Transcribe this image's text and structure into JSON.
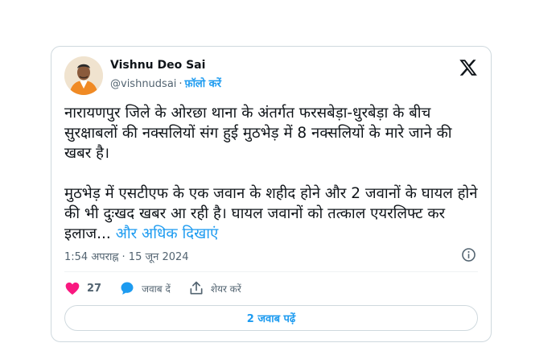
{
  "author": {
    "name": "Vishnu Deo Sai",
    "handle": "@vishnudsai",
    "separator": "·",
    "follow_label": "फ़ॉलो करें"
  },
  "tweet": {
    "paragraph1": "नारायणपुर जिले के ओरछा थाना के अंतर्गत फरसबेड़ा-धुरबेड़ा के बीच सुरक्षाबलों की नक्सलियों संग हुई मुठभेड़ में 8 नक्सलियों के मारे जाने की खबर है।",
    "paragraph2": "मुठभेड़ में एसटीएफ के एक जवान के शहीद होने और 2 जवानों के घायल होने की भी दुःखद खबर आ रही है। घायल जवानों को तत्काल एयरलिफ्ट कर इलाज...",
    "show_more": "और अधिक दिखाएं",
    "timestamp": "1:54 अपराह्न · 15 जून 2024"
  },
  "actions": {
    "likes": "27",
    "reply_label": "जवाब दें",
    "share_label": "शेयर करें"
  },
  "replies_button": "2 जवाब पढ़ें",
  "icons": [
    "x-logo-icon",
    "info-icon",
    "heart-icon",
    "reply-bubble-icon",
    "share-icon"
  ],
  "colors": {
    "accent": "#1d9bf0",
    "like": "#f91880",
    "text": "#0f1419",
    "muted": "#536471",
    "border": "#cfd9de"
  }
}
